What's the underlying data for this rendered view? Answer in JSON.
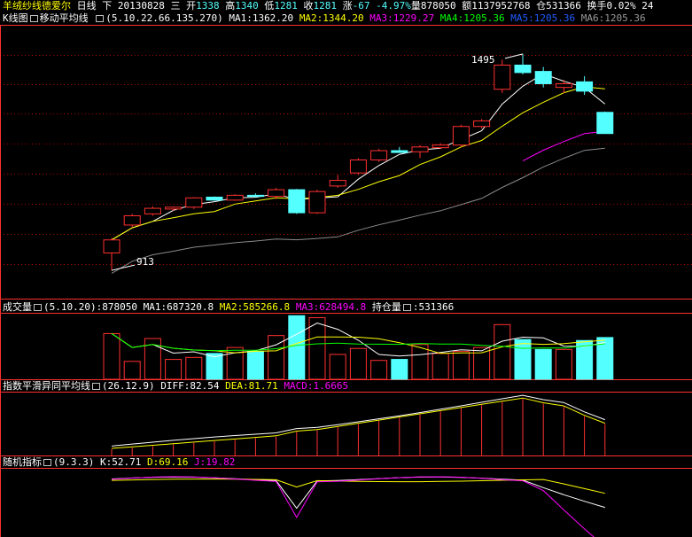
{
  "header": {
    "stock_name": "羊绒纱线德爱尔",
    "period": "日线",
    "nav": "下",
    "date": "20130828",
    "weekday": "三",
    "open_label": "开",
    "open": "1338",
    "high_label": "高",
    "high": "1340",
    "low_label": "低",
    "low": "1281",
    "close_label": "收",
    "close": "1281",
    "change_label": "涨",
    "change": "-67",
    "pct": "-4.97%",
    "vol_label": "量",
    "vol": "878050",
    "amount_label": "额",
    "amount": "1137952768",
    "oi_label": "仓",
    "oi": "531366",
    "turnover_label": "换手",
    "turnover": "0.02%",
    "turnover_extra": "24"
  },
  "panels": {
    "kline": {
      "title": "K线图",
      "indicator": "移动平均线",
      "params": "(5.10.22.66.135.270)",
      "ma1": "MA1:1362.20",
      "ma2": "MA2:1344.20",
      "ma3": "MA3:1229.27",
      "ma4": "MA4:1205.36",
      "ma5": "MA5:1205.36",
      "ma6": "MA6:1205.36",
      "high_annot": "1495",
      "low_annot": "913"
    },
    "volume": {
      "title": "成交量",
      "params": "(5.10.20)",
      "value": ":878050",
      "ma1": "MA1:687320.8",
      "ma2": "MA2:585266.8",
      "ma3": "MA3:628494.8",
      "oi_label": "持仓量",
      "oi_value": ":531366"
    },
    "macd": {
      "title": "指数平滑异同平均线",
      "params": "(26.12.9)",
      "diff": "DIFF:82.54",
      "dea": "DEA:81.71",
      "macd": "MACD:1.6665"
    },
    "kdj": {
      "title": "随机指标",
      "params": "(9.3.3)",
      "k": "K:52.71",
      "d": "D:69.16",
      "j": "J:19.82"
    }
  },
  "colors": {
    "up": "#ff3030",
    "down": "#54ffff",
    "ma1": "#ffffff",
    "ma2": "#ffff00",
    "ma3": "#ff00ff",
    "ma4": "#00ff00",
    "grid": "#b00000",
    "divider": "#ff3030"
  },
  "chart_data": {
    "type": "candlestick",
    "candles": [
      {
        "o": 960,
        "h": 1000,
        "l": 913,
        "c": 995,
        "up": true
      },
      {
        "o": 1035,
        "h": 1065,
        "l": 1030,
        "c": 1060,
        "up": true
      },
      {
        "o": 1065,
        "h": 1085,
        "l": 1060,
        "c": 1080,
        "up": true
      },
      {
        "o": 1078,
        "h": 1085,
        "l": 1073,
        "c": 1083,
        "up": true
      },
      {
        "o": 1083,
        "h": 1110,
        "l": 1078,
        "c": 1108,
        "up": true
      },
      {
        "o": 1110,
        "h": 1112,
        "l": 1100,
        "c": 1102,
        "up": false
      },
      {
        "o": 1102,
        "h": 1118,
        "l": 1100,
        "c": 1115,
        "up": true
      },
      {
        "o": 1115,
        "h": 1120,
        "l": 1110,
        "c": 1112,
        "up": false
      },
      {
        "o": 1112,
        "h": 1135,
        "l": 1105,
        "c": 1130,
        "up": true
      },
      {
        "o": 1130,
        "h": 1132,
        "l": 1065,
        "c": 1068,
        "up": false
      },
      {
        "o": 1068,
        "h": 1130,
        "l": 1065,
        "c": 1125,
        "up": true
      },
      {
        "o": 1155,
        "h": 1170,
        "l": 1135,
        "c": 1140,
        "up": true
      },
      {
        "o": 1175,
        "h": 1215,
        "l": 1170,
        "c": 1210,
        "up": true
      },
      {
        "o": 1210,
        "h": 1240,
        "l": 1205,
        "c": 1235,
        "up": true
      },
      {
        "o": 1235,
        "h": 1245,
        "l": 1230,
        "c": 1230,
        "up": false
      },
      {
        "o": 1232,
        "h": 1250,
        "l": 1215,
        "c": 1245,
        "up": true
      },
      {
        "o": 1243,
        "h": 1255,
        "l": 1240,
        "c": 1250,
        "up": true
      },
      {
        "o": 1250,
        "h": 1305,
        "l": 1245,
        "c": 1300,
        "up": true
      },
      {
        "o": 1300,
        "h": 1320,
        "l": 1295,
        "c": 1315,
        "up": true
      },
      {
        "o": 1400,
        "h": 1480,
        "l": 1390,
        "c": 1465,
        "up": true
      },
      {
        "o": 1465,
        "h": 1495,
        "l": 1440,
        "c": 1445,
        "up": false
      },
      {
        "o": 1448,
        "h": 1460,
        "l": 1405,
        "c": 1415,
        "up": false
      },
      {
        "o": 1415,
        "h": 1425,
        "l": 1390,
        "c": 1405,
        "up": true
      },
      {
        "o": 1420,
        "h": 1435,
        "l": 1385,
        "c": 1395,
        "up": false
      },
      {
        "o": 1338,
        "h": 1340,
        "l": 1281,
        "c": 1281,
        "up": false
      }
    ],
    "volume": [
      46,
      18,
      41,
      20,
      22,
      26,
      32,
      28,
      44,
      64,
      62,
      25,
      31,
      19,
      20,
      35,
      26,
      28,
      32,
      55,
      40,
      30,
      30,
      39,
      42
    ],
    "macd_hist": [
      8,
      10,
      12,
      14,
      16,
      18,
      20,
      22,
      24,
      30,
      32,
      36,
      40,
      44,
      48,
      52,
      56,
      60,
      64,
      68,
      72,
      66,
      62,
      50,
      40
    ]
  }
}
